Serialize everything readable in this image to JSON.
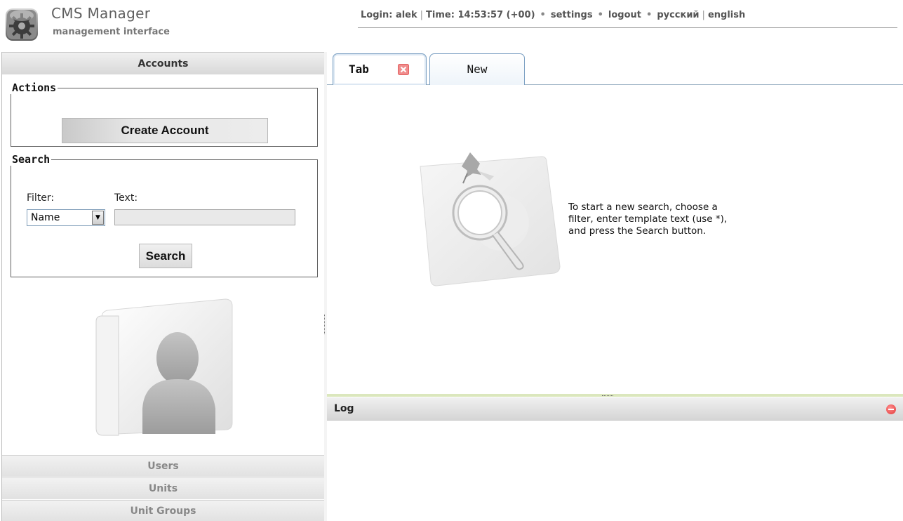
{
  "header": {
    "title": "CMS Manager",
    "subtitle": "management interface",
    "login": "Login: alek",
    "time": "Time: 14:53:57 (+00)",
    "settings": "settings",
    "logout": "logout",
    "lang_ru": "русский",
    "lang_en": "english",
    "separator": "|",
    "dot": "•"
  },
  "sidebar": {
    "accounts_header": "Accounts",
    "actions": {
      "legend": "Actions",
      "create_button": "Create Account"
    },
    "search": {
      "legend": "Search",
      "filter_label": "Filter:",
      "text_label": "Text:",
      "filter_value": "Name",
      "text_value": "",
      "search_button": "Search"
    },
    "nav_items": [
      {
        "label": "Users"
      },
      {
        "label": "Units"
      },
      {
        "label": "Unit Groups"
      }
    ]
  },
  "tabs": [
    {
      "label": "Tab",
      "closable": true,
      "active": true
    },
    {
      "label": "New",
      "closable": false,
      "active": false
    }
  ],
  "content": {
    "hint_line1": "To start a new search, choose a",
    "hint_line2": "filter, enter template text (use *),",
    "hint_line3": "and press the Search button."
  },
  "log": {
    "title": "Log"
  },
  "colors": {
    "tab_border": "#7a9fc2",
    "splitter": "#dbe7bd",
    "close_icon": "#e65a5a"
  }
}
